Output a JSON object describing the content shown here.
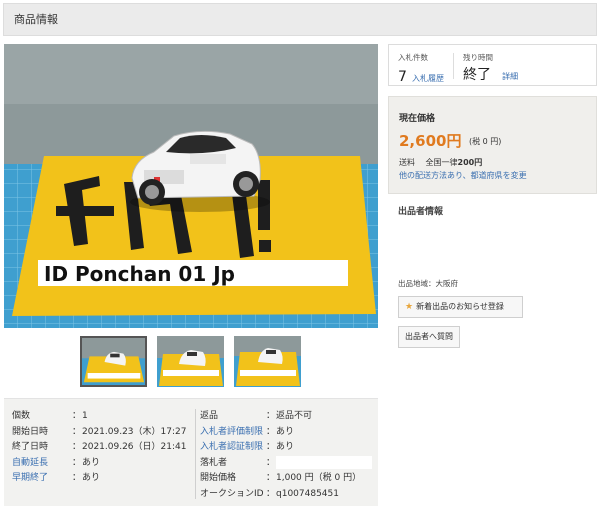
{
  "header": {
    "title": "商品情報"
  },
  "photo": {
    "sign_text": "ヤイマ!",
    "plate_text": "ID Ponchan 01 Jp",
    "thumb_plate_text": "ID Ponchan 01 Jp"
  },
  "bids": {
    "count_label": "入札件数",
    "count_value": "7",
    "history_link": "入札履歴",
    "time_label": "残り時間",
    "time_value": "終了",
    "detail_link": "詳細"
  },
  "price": {
    "label": "現在価格",
    "value": "2,600円",
    "tax": "(税 0 円)",
    "shipping_label": "送料",
    "shipping_text": "全国一律",
    "shipping_value": "200円",
    "shipping_link": "他の配送方法あり、都道府県を変更"
  },
  "seller": {
    "title": "出品者情報",
    "area": "出品地域：大阪府",
    "notify_button": "新着出品のお知らせ登録",
    "contact_button": "出品者へ質問"
  },
  "details_left": [
    {
      "label": "個数",
      "value": "1",
      "link": false
    },
    {
      "label": "開始日時",
      "value": "2021.09.23（木）17:27",
      "link": false
    },
    {
      "label": "終了日時",
      "value": "2021.09.26（日）21:41",
      "link": false
    },
    {
      "label": "自動延長",
      "value": "あり",
      "link": true
    },
    {
      "label": "早期終了",
      "value": "あり",
      "link": true
    }
  ],
  "details_right": [
    {
      "label": "返品",
      "value": "返品不可",
      "link": false
    },
    {
      "label": "入札者評価制限",
      "value": "あり",
      "link": true
    },
    {
      "label": "入札者認証制限",
      "value": "あり",
      "link": true
    },
    {
      "label": "落札者",
      "value": "",
      "link": false
    },
    {
      "label": "開始価格",
      "value": "1,000 円（税 0 円）",
      "link": false
    },
    {
      "label": "オークションID",
      "value": "q1007485451",
      "link": false
    }
  ],
  "colors": {
    "price": "#e07a1f",
    "link": "#3a6fb0",
    "panel_bg": "#f0efec"
  }
}
